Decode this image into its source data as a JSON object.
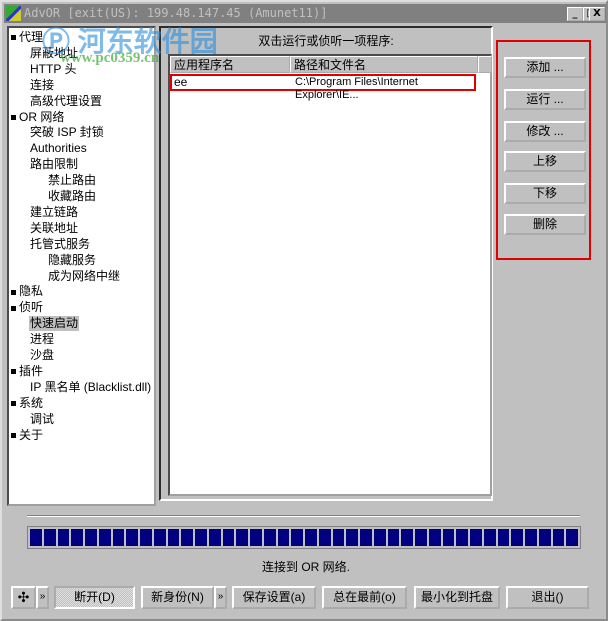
{
  "window": {
    "title": "AdvOR [exit(US): 199.48.147.45 (Amunet11)]",
    "minimize": "_",
    "maximize": "□",
    "close": "X"
  },
  "watermark": {
    "name": "河东软件园",
    "url": "www.pc0359.cn"
  },
  "tree": [
    {
      "label": "代理",
      "level": 0
    },
    {
      "label": "屏蔽地址",
      "level": 1
    },
    {
      "label": "HTTP 头",
      "level": 1
    },
    {
      "label": "连接",
      "level": 1
    },
    {
      "label": "高级代理设置",
      "level": 1
    },
    {
      "label": "OR 网络",
      "level": 0
    },
    {
      "label": "突破 ISP 封锁",
      "level": 1
    },
    {
      "label": "Authorities",
      "level": 1
    },
    {
      "label": "路由限制",
      "level": 1
    },
    {
      "label": "禁止路由",
      "level": 2
    },
    {
      "label": "收藏路由",
      "level": 2
    },
    {
      "label": "建立链路",
      "level": 1
    },
    {
      "label": "关联地址",
      "level": 1
    },
    {
      "label": "托管式服务",
      "level": 1
    },
    {
      "label": "隐藏服务",
      "level": 2
    },
    {
      "label": "成为网络中继",
      "level": 2
    },
    {
      "label": "隐私",
      "level": 0
    },
    {
      "label": "侦听",
      "level": 0
    },
    {
      "label": "快速启动",
      "level": 1,
      "selected": true
    },
    {
      "label": "进程",
      "level": 1
    },
    {
      "label": "沙盘",
      "level": 1
    },
    {
      "label": "插件",
      "level": 0
    },
    {
      "label": "IP 黑名单 (Blacklist.dll)",
      "level": 1
    },
    {
      "label": "系统",
      "level": 0
    },
    {
      "label": "调试",
      "level": 1
    },
    {
      "label": "关于",
      "level": 0
    }
  ],
  "main": {
    "prompt": "双击运行或侦听一项程序:",
    "columns": [
      "应用程序名",
      "路径和文件名"
    ],
    "rows": [
      {
        "name": "ee",
        "path": "C:\\Program Files\\Internet Explorer\\IE..."
      }
    ]
  },
  "actions": [
    "添加 ...",
    "运行 ...",
    "修改 ...",
    "上移",
    "下移",
    "删除"
  ],
  "progress": {
    "percent": 100,
    "color": "#000080"
  },
  "status": "连接到 OR 网络.",
  "bottom": {
    "disconnect": "断开(D)",
    "new_identity": "新身份(N)",
    "save": "保存设置(a)",
    "on_top": "总在最前(o)",
    "tray": "最小化到托盘",
    "exit": "退出()",
    "more": "»"
  }
}
